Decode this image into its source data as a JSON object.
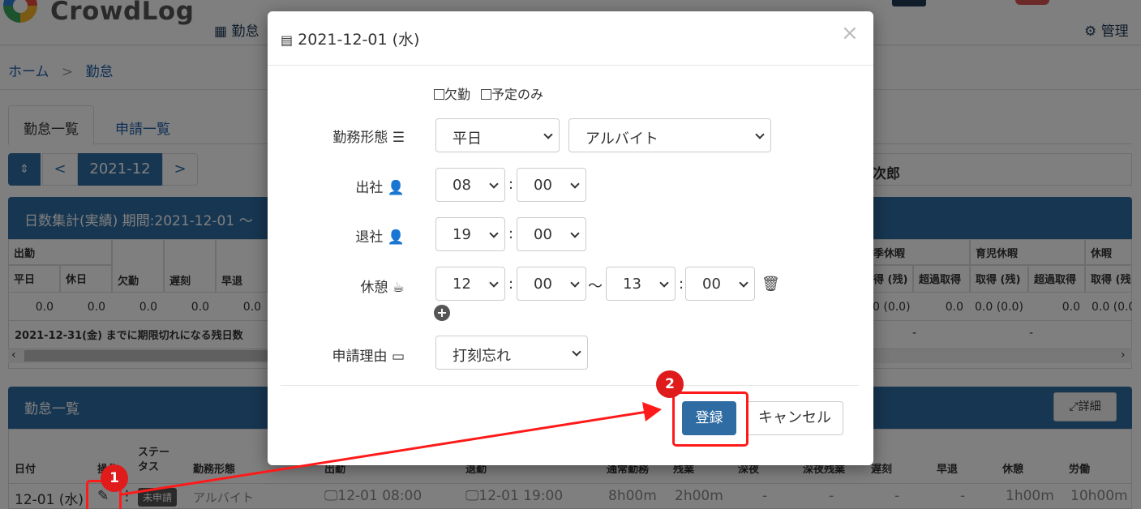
{
  "app": {
    "name": "CrowdLog"
  },
  "topnav": {
    "attendance": "勤怠",
    "admin": "管理"
  },
  "breadcrumb": {
    "home": "ホーム",
    "sep": ">",
    "current": "勤怠"
  },
  "tabs": {
    "attendance_list": "勤怠一覧",
    "request_list": "申請一覧"
  },
  "month_nav": {
    "prev": "<",
    "month": "2021-12",
    "next": ">"
  },
  "user_name": "次郎",
  "summary": {
    "title": "日数集計(実績)  期間:2021-12-01 ～",
    "group_label": "出勤",
    "headers": [
      "平日",
      "休日",
      "欠勤",
      "遅刻",
      "早退"
    ],
    "values": [
      "0.0",
      "0.0",
      "0.0",
      "0.0",
      "0.0"
    ],
    "expiry_note": "2021-12-31(金) までに期限切れになる残日数",
    "right_groups": [
      "季休暇",
      "育児休暇",
      "休暇"
    ],
    "right_headers": [
      "得 (残)",
      "超過取得",
      "取得 (残)",
      "超過取得",
      "取得 (残"
    ],
    "right_values": [
      "0 (0.0)",
      "0.0",
      "0.0 (0.0)",
      "0.0",
      "0.0 (0.0"
    ],
    "right_dash": [
      "-",
      "-"
    ]
  },
  "list": {
    "title": "勤怠一覧",
    "detail_button": "詳細",
    "headers": [
      "日付",
      "操作",
      "ステータス",
      "勤務形態",
      "出勤",
      "退勤",
      "通常勤務",
      "残業",
      "深夜",
      "深夜残業",
      "遅刻",
      "早退",
      "休憩",
      "労働"
    ],
    "row": {
      "date": "12-01 (水)",
      "status": "未申請",
      "work_type": "アルバイト",
      "in": "12-01 08:00",
      "out": "12-01 19:00",
      "normal": "8h00m",
      "overtime": "2h00m",
      "night": "-",
      "night_ot": "-",
      "late": "-",
      "early": "-",
      "break": "1h00m",
      "work": "10h00m"
    }
  },
  "modal": {
    "title": "2021-12-01 (水)",
    "absent_label": "欠勤",
    "plan_only_label": "予定のみ",
    "work_type_label": "勤務形態",
    "work_type_day": "平日",
    "work_type_kind": "アルバイト",
    "clock_in_label": "出社",
    "clock_in_h": "08",
    "clock_in_m": "00",
    "clock_out_label": "退社",
    "clock_out_h": "19",
    "clock_out_m": "00",
    "break_label": "休憩",
    "break_start_h": "12",
    "break_start_m": "00",
    "break_end_h": "13",
    "break_end_m": "00",
    "tilde": "〜",
    "reason_label": "申請理由",
    "reason_value": "打刻忘れ",
    "register": "登録",
    "cancel": "キャンセル",
    "close": "×"
  },
  "annotations": {
    "step1": "1",
    "step2": "2",
    "color": "#ff1a1a"
  }
}
